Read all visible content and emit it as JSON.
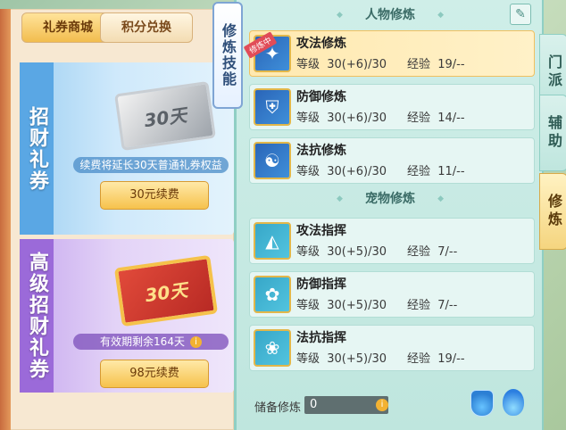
{
  "shop": {
    "tabs": [
      "礼券商城",
      "积分兑换"
    ],
    "cards": [
      {
        "side_label": "招财礼券",
        "ticket_label": "30天",
        "note": "续费将延长30天普通礼券权益",
        "button": "30元续费"
      },
      {
        "side_label": "高级招财礼券",
        "ticket_label": "30天",
        "note": "有效期剩余164天",
        "button": "98元续费"
      }
    ]
  },
  "side_tab": "修炼技能",
  "headers": {
    "character": "人物修炼",
    "pet": "宠物修炼"
  },
  "training_badge": "修炼中",
  "skills": [
    {
      "name": "攻法修炼",
      "level": "等级  30(+6)/30",
      "exp": "经验  19/--"
    },
    {
      "name": "防御修炼",
      "level": "等级  30(+6)/30",
      "exp": "经验  14/--"
    },
    {
      "name": "法抗修炼",
      "level": "等级  30(+6)/30",
      "exp": "经验  11/--"
    },
    {
      "name": "攻法指挥",
      "level": "等级  30(+5)/30",
      "exp": "经验  7/--"
    },
    {
      "name": "防御指挥",
      "level": "等级  30(+5)/30",
      "exp": "经验  7/--"
    },
    {
      "name": "法抗指挥",
      "level": "等级  30(+5)/30",
      "exp": "经验  19/--"
    }
  ],
  "reserve": {
    "label": "储备修炼",
    "value": "0"
  },
  "category_tabs": [
    "门派",
    "辅助",
    "修炼"
  ],
  "icons": {
    "edit": "edit-icon",
    "potion": "potion-icon",
    "flame": "flame-icon",
    "info": "i"
  }
}
